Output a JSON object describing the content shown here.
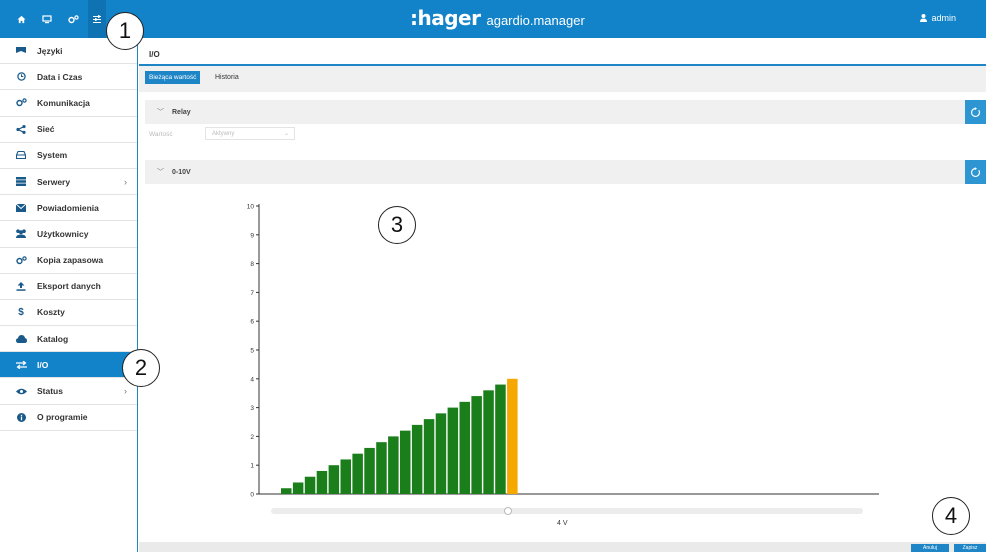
{
  "app": {
    "brand_logo": ":hager",
    "brand_product": "agardio.manager",
    "user": "admin",
    "accent": "#1282c9"
  },
  "topbar": {
    "icons": [
      "home-icon",
      "monitor-icon",
      "settings-cogs-icon",
      "sliders-icon"
    ],
    "active_icon": "sliders-icon"
  },
  "sidebar": {
    "items": [
      {
        "label": "Języki",
        "icon": "flag-icon"
      },
      {
        "label": "Data i Czas",
        "icon": "clock-icon"
      },
      {
        "label": "Komunikacja",
        "icon": "cogs-icon"
      },
      {
        "label": "Sieć",
        "icon": "share-icon"
      },
      {
        "label": "System",
        "icon": "drive-icon"
      },
      {
        "label": "Serwery",
        "icon": "server-icon",
        "chevron": "›"
      },
      {
        "label": "Powiadomienia",
        "icon": "envelope-icon"
      },
      {
        "label": "Użytkownicy",
        "icon": "users-icon"
      },
      {
        "label": "Kopia zapasowa",
        "icon": "cogs-icon"
      },
      {
        "label": "Eksport danych",
        "icon": "upload-icon"
      },
      {
        "label": "Koszty",
        "icon": "dollar-icon"
      },
      {
        "label": "Katalog",
        "icon": "cloud-icon"
      },
      {
        "label": "I/O",
        "icon": "exchange-icon",
        "active": true
      },
      {
        "label": "Status",
        "icon": "eye-icon",
        "chevron": "›"
      },
      {
        "label": "O programie",
        "icon": "info-icon"
      }
    ]
  },
  "main": {
    "title": "I/O",
    "tabs": [
      {
        "label": "Bieżąca wartość",
        "active": true
      },
      {
        "label": "Historia",
        "active": false
      }
    ],
    "relay_section": {
      "title": "Relay",
      "field_label": "Wartość",
      "field_value": "Aktywny",
      "field_arrow": "⌄"
    },
    "analog_section": {
      "title": "0-10V"
    },
    "slider_label": "4 V",
    "buttons": {
      "cancel": "Anuluj",
      "save": "Zapisz"
    }
  },
  "callouts": [
    "1",
    "2",
    "3",
    "4"
  ],
  "chart_data": {
    "type": "bar",
    "ylim": [
      0,
      10
    ],
    "yticks": [
      "0",
      "1",
      "2",
      "3",
      "4",
      "5",
      "6",
      "7",
      "8",
      "9",
      "10"
    ],
    "values": [
      0.2,
      0.4,
      0.6,
      0.8,
      1.0,
      1.2,
      1.4,
      1.6,
      1.8,
      2.0,
      2.2,
      2.4,
      2.6,
      2.8,
      3.0,
      3.2,
      3.4,
      3.6,
      3.8,
      4.0
    ],
    "bar_colors": [
      "#1a7f1a",
      "#f5a800"
    ],
    "highlight_index": 19,
    "xlim": [
      0,
      50
    ]
  }
}
